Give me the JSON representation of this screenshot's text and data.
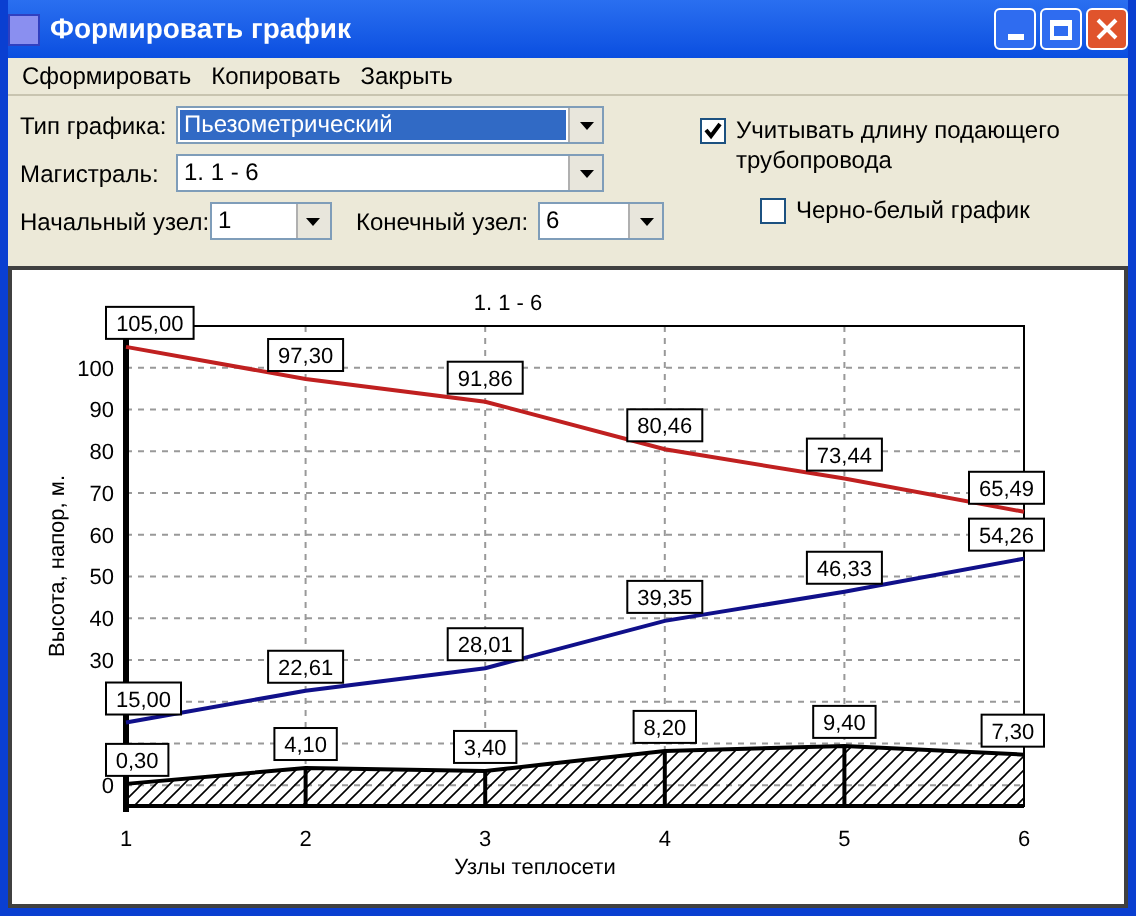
{
  "window": {
    "title": "Формировать график"
  },
  "menu": [
    "Сформировать",
    "Копировать",
    "Закрыть"
  ],
  "form": {
    "chart_type": {
      "label": "Тип графика:",
      "value": "Пьезометрический",
      "selected": true
    },
    "main_line": {
      "label": "Магистраль:",
      "value": "1.  1 - 6",
      "selected": false
    },
    "start_node": {
      "label": "Начальный узел:",
      "value": "1"
    },
    "end_node": {
      "label": "Конечный узел:",
      "value": "6"
    },
    "options": [
      {
        "label": "Учитывать длину подающего трубопровода",
        "checked": true
      },
      {
        "label": "Черно-белый график",
        "checked": false
      }
    ]
  },
  "chart": {
    "chart_data": {
      "type": "line",
      "title": "1.  1 - 6",
      "xlabel": "Узлы теплосети",
      "ylabel": "Высота, напор, м.",
      "categories": [
        "1",
        "2",
        "3",
        "4",
        "5",
        "6"
      ],
      "grid": true,
      "ylim": [
        -5,
        110
      ],
      "yticks": [
        0,
        30,
        40,
        50,
        60,
        70,
        80,
        90,
        100
      ],
      "series": [
        {
          "color": "#c02020",
          "values": [
            105.0,
            97.3,
            91.86,
            80.46,
            73.44,
            65.49
          ],
          "value_labels": [
            "105,00",
            "97,30",
            "91,86",
            "80,46",
            "73,44",
            "65,49"
          ]
        },
        {
          "color": "#10108a",
          "values": [
            15.0,
            22.61,
            28.01,
            39.35,
            46.33,
            54.26
          ],
          "value_labels": [
            "15,00",
            "22,61",
            "28,01",
            "39,35",
            "46,33",
            "54,26"
          ]
        },
        {
          "color": "#000000",
          "values": [
            0.3,
            4.1,
            3.4,
            8.2,
            9.4,
            7.3
          ],
          "value_labels": [
            "0,30",
            "4,10",
            "3,40",
            "8,20",
            "9,40",
            "7,30"
          ]
        }
      ]
    }
  }
}
